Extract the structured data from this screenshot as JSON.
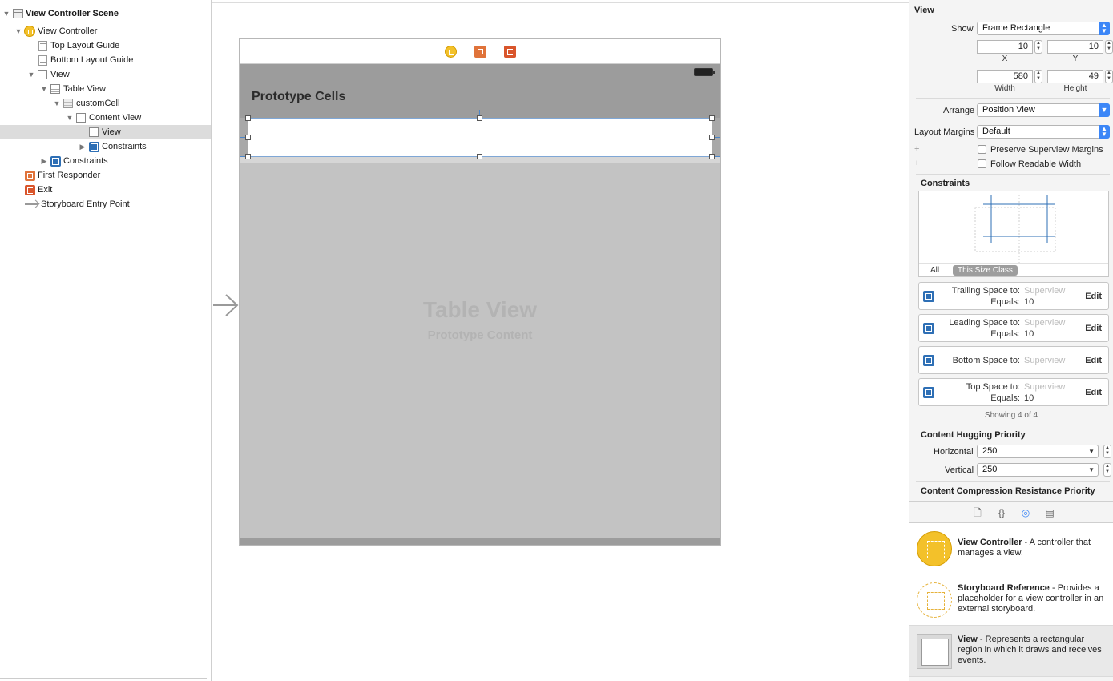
{
  "outline": {
    "items": [
      {
        "label": "View Controller Scene",
        "icon": "scene-icon"
      },
      {
        "label": "View Controller",
        "icon": "view-controller-icon"
      },
      {
        "label": "Top Layout Guide",
        "icon": "layout-guide-icon"
      },
      {
        "label": "Bottom Layout Guide",
        "icon": "layout-guide-icon"
      },
      {
        "label": "View",
        "icon": "view-icon"
      },
      {
        "label": "Table View",
        "icon": "table-view-icon"
      },
      {
        "label": "customCell",
        "icon": "table-cell-icon"
      },
      {
        "label": "Content View",
        "icon": "view-icon"
      },
      {
        "label": "View",
        "icon": "view-icon"
      },
      {
        "label": "Constraints",
        "icon": "constraints-icon"
      },
      {
        "label": "Constraints",
        "icon": "constraints-icon"
      },
      {
        "label": "First Responder",
        "icon": "first-responder-icon"
      },
      {
        "label": "Exit",
        "icon": "exit-icon"
      },
      {
        "label": "Storyboard Entry Point",
        "icon": "entry-arrow-icon"
      }
    ],
    "selected_index": 8
  },
  "canvas": {
    "prototype_title": "Prototype Cells",
    "table_label": "Table View",
    "table_sublabel": "Prototype Content"
  },
  "inspector": {
    "section_title": "View",
    "show_label": "Show",
    "show_value": "Frame Rectangle",
    "x_value": "10",
    "x_label": "X",
    "y_value": "10",
    "y_label": "Y",
    "width_value": "580",
    "width_label": "Width",
    "height_value": "49",
    "height_label": "Height",
    "arrange_label": "Arrange",
    "arrange_value": "Position View",
    "margins_label": "Layout Margins",
    "margins_value": "Default",
    "preserve_label": "Preserve Superview Margins",
    "follow_label": "Follow Readable Width",
    "constraints_title": "Constraints",
    "tab_all": "All",
    "tab_size_class": "This Size Class",
    "constraints": [
      {
        "title": "Trailing Space to:",
        "target": "Superview",
        "equals_label": "Equals:",
        "value": "10",
        "edit": "Edit"
      },
      {
        "title": "Leading Space to:",
        "target": "Superview",
        "equals_label": "Equals:",
        "value": "10",
        "edit": "Edit"
      },
      {
        "title": "Bottom Space to:",
        "target": "Superview",
        "equals_label": "",
        "value": "",
        "edit": "Edit"
      },
      {
        "title": "Top Space to:",
        "target": "Superview",
        "equals_label": "Equals:",
        "value": "10",
        "edit": "Edit"
      }
    ],
    "showing_text": "Showing 4 of 4",
    "hugging_title": "Content Hugging Priority",
    "horizontal_label": "Horizontal",
    "horizontal_value": "250",
    "vertical_label": "Vertical",
    "vertical_value": "250",
    "compression_title": "Content Compression Resistance Priority"
  },
  "library": {
    "items": [
      {
        "name": "View Controller",
        "desc": " - A controller that manages a view."
      },
      {
        "name": "Storyboard Reference",
        "desc": " - Provides a placeholder for a view controller in an external storyboard."
      },
      {
        "name": "View",
        "desc": " - Represents a rectangular region in which it draws and receives events."
      }
    ]
  },
  "colors": {
    "accent": "#3b86f7",
    "constraint_blue": "#2e6fb5",
    "view_controller_yellow": "#f3c12a",
    "first_responder_orange": "#e0733a"
  }
}
